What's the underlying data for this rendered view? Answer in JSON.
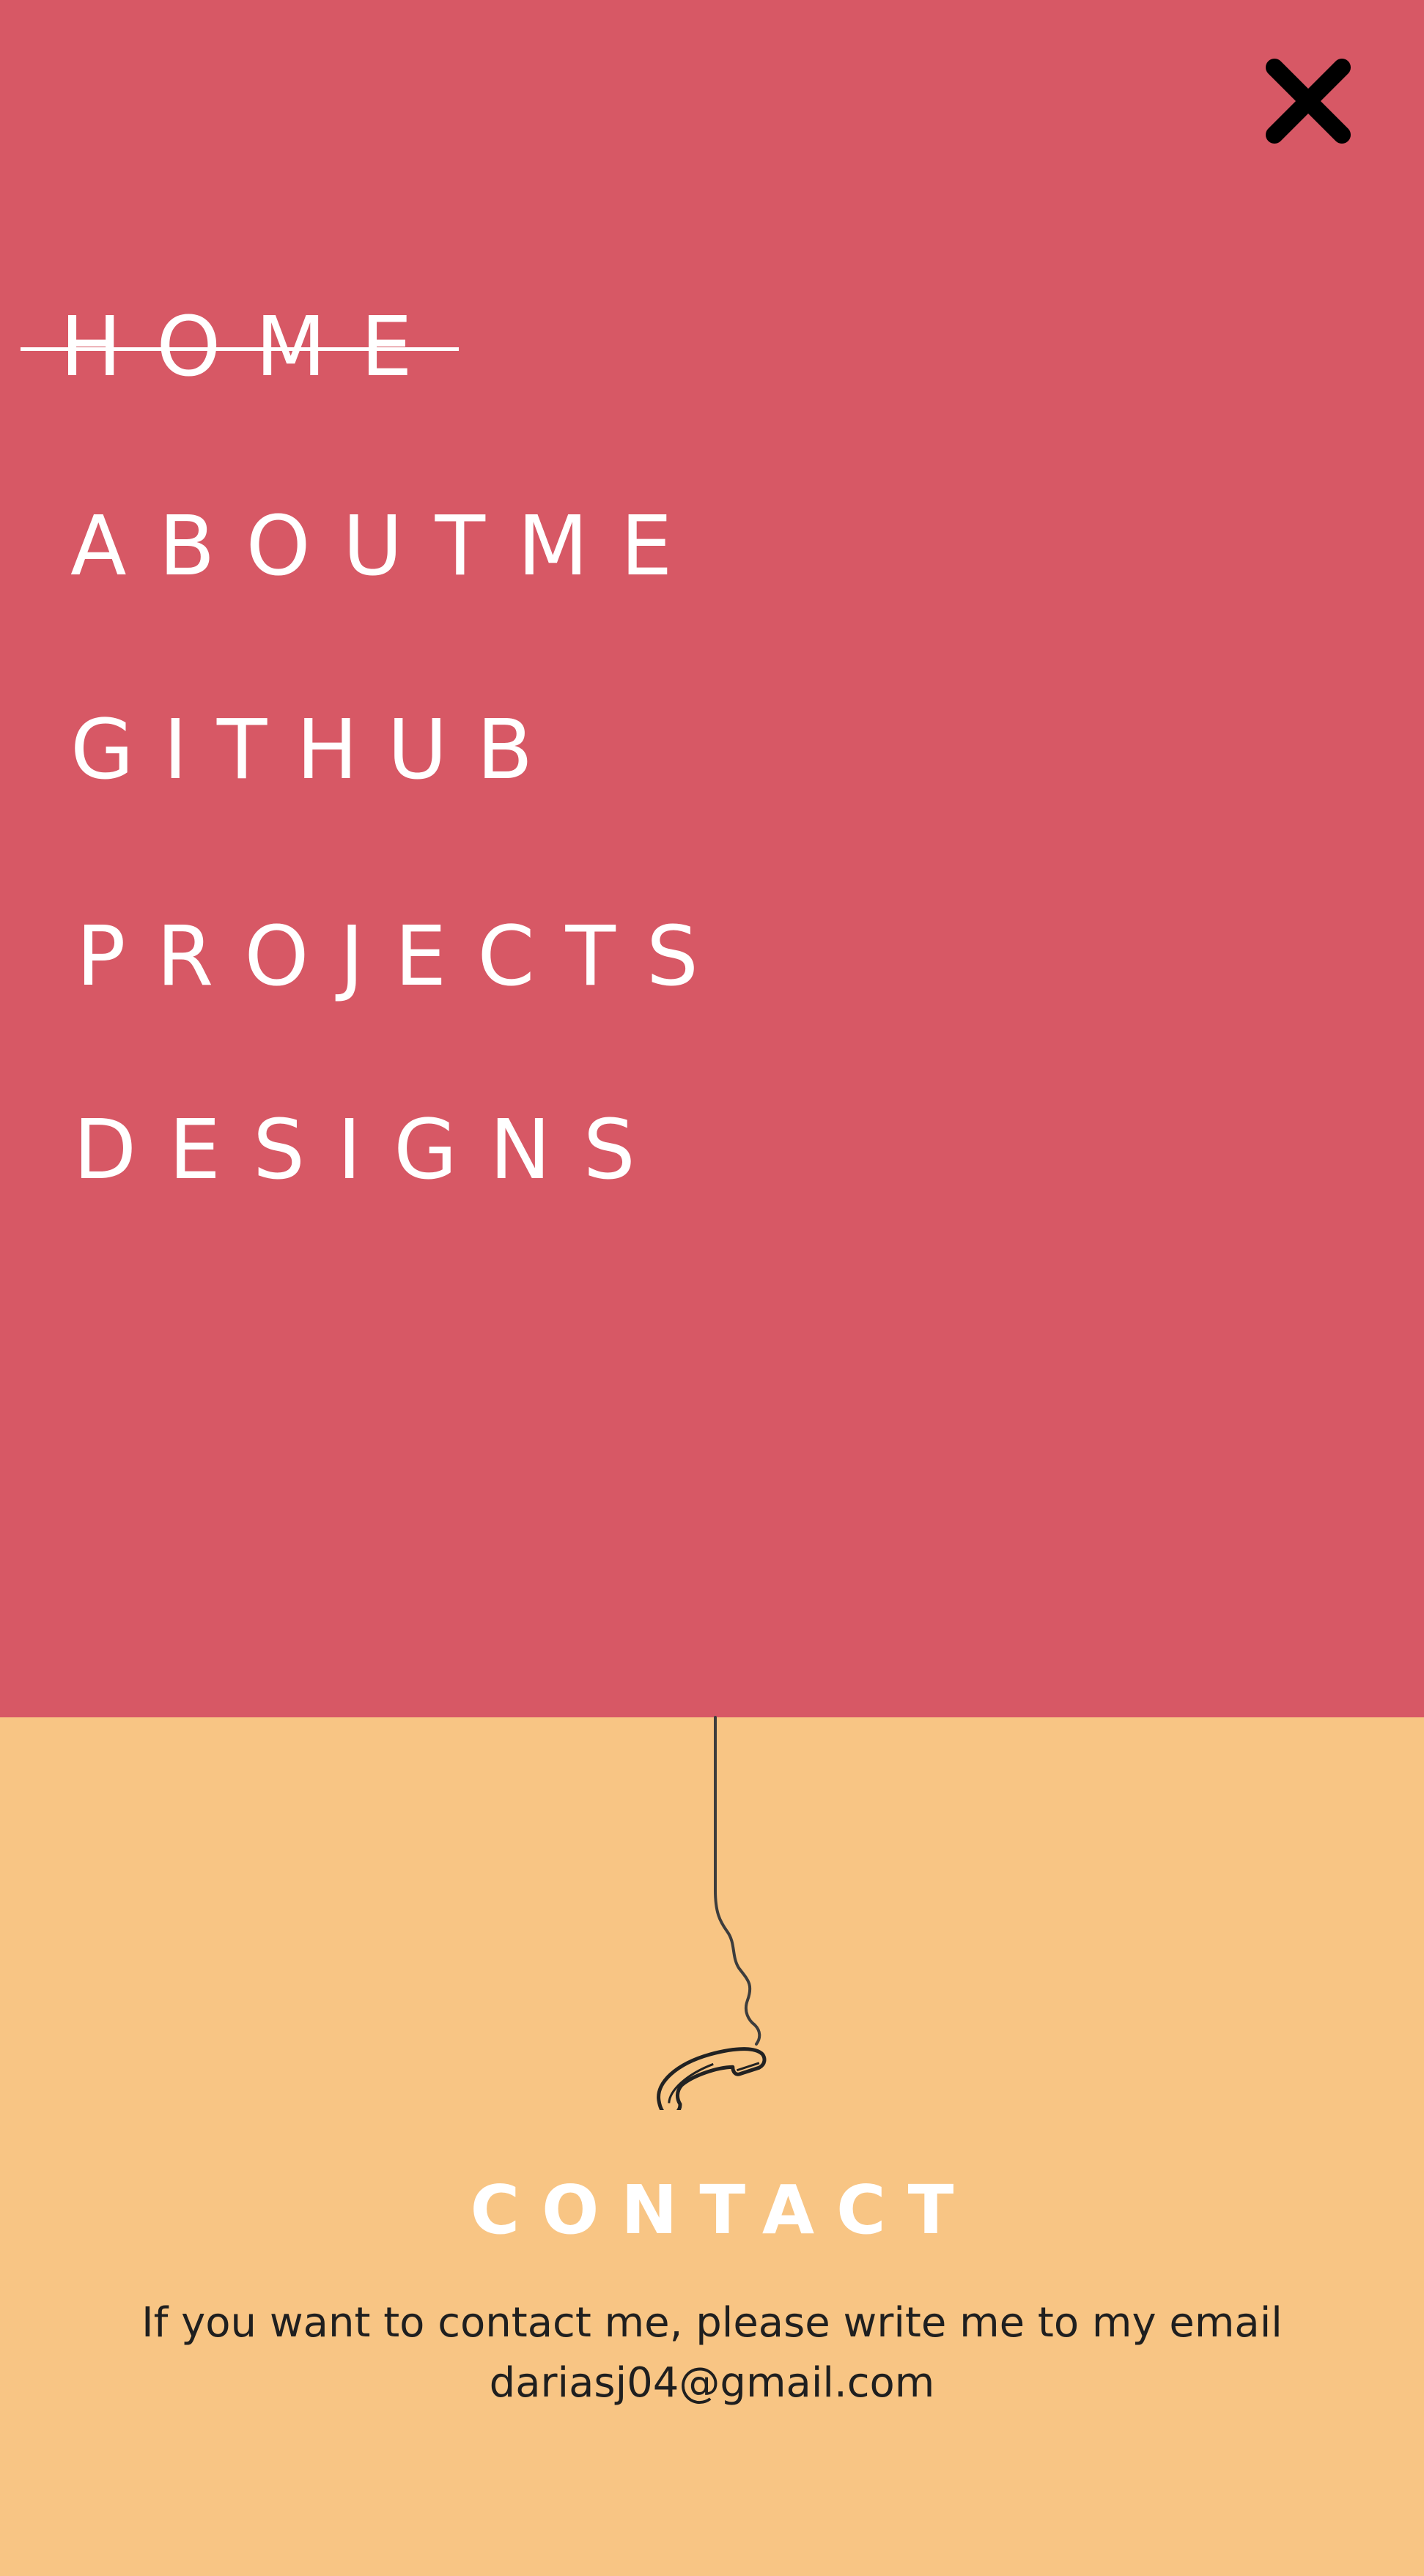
{
  "colors": {
    "menu_background": "#d75865",
    "contact_background": "#f8c584",
    "menu_text": "#ffffff",
    "close_icon": "#000000",
    "body_text": "#1f1f1f"
  },
  "close": {
    "icon": "close-icon"
  },
  "nav": {
    "items": [
      {
        "label": "HOME",
        "active": true
      },
      {
        "label": "ABOUTME",
        "active": false
      },
      {
        "label": "GITHUB",
        "active": false
      },
      {
        "label": "PROJECTS",
        "active": false
      },
      {
        "label": "DESIGNS",
        "active": false
      }
    ]
  },
  "contact": {
    "illustration": "hanging-phone-icon",
    "title": "CONTACT",
    "line1": "If you want to contact me, please write me to my email",
    "email": "dariasj04@gmail.com"
  }
}
